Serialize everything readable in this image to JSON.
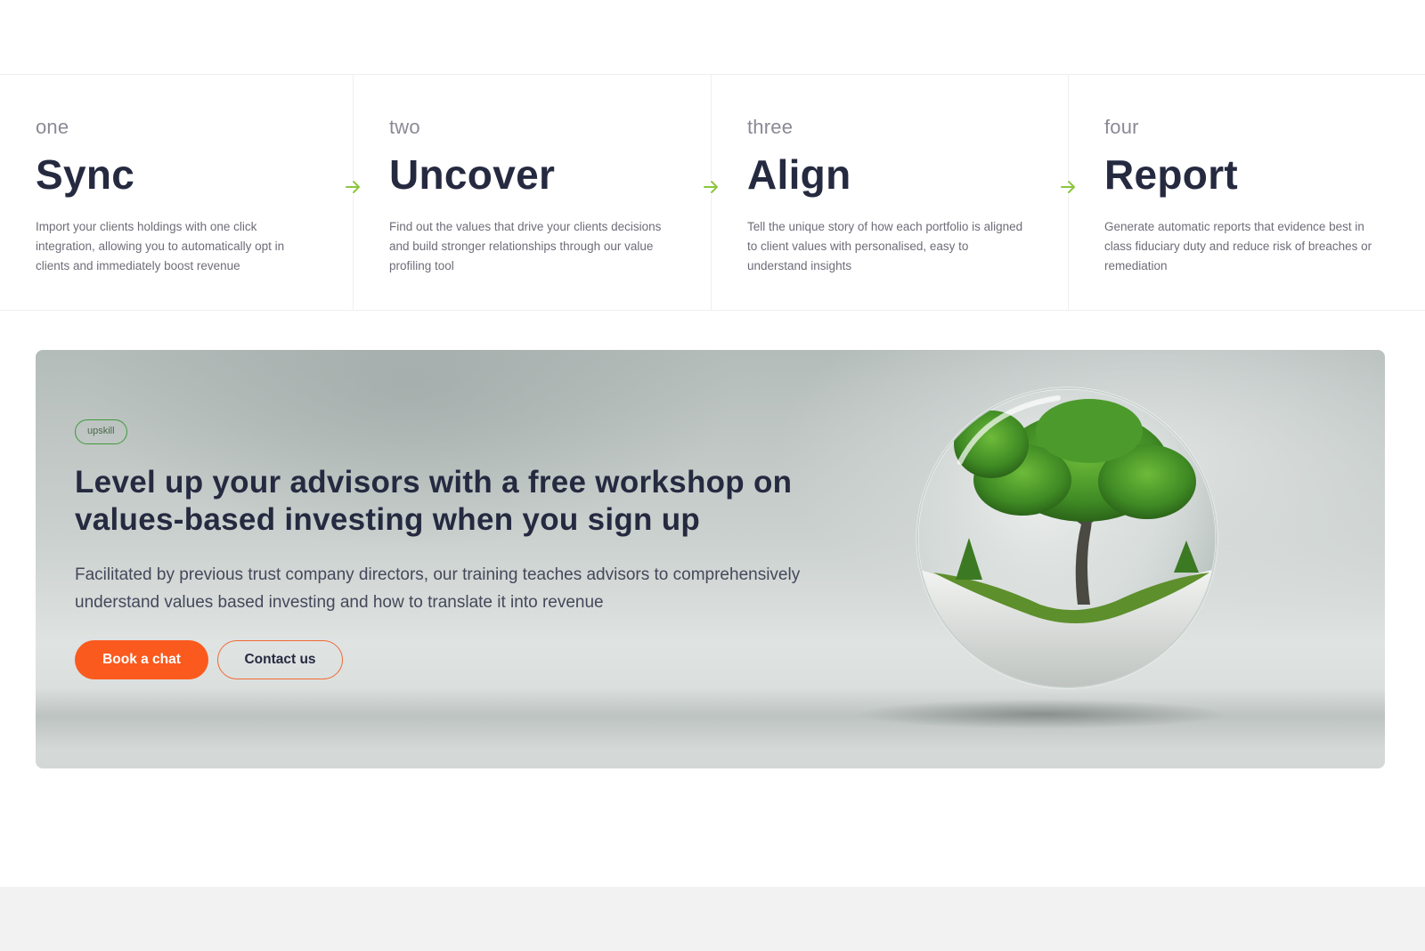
{
  "steps": [
    {
      "number": "one",
      "title": "Sync",
      "description": "Import your clients holdings with one click integration, allowing you to automatically opt in clients and immediately boost revenue"
    },
    {
      "number": "two",
      "title": "Uncover",
      "description": "Find out the values that drive your clients decisions and build stronger relationships through our value profiling tool"
    },
    {
      "number": "three",
      "title": "Align",
      "description": "Tell the unique story of how each portfolio is aligned to client values with personalised, easy to understand insights"
    },
    {
      "number": "four",
      "title": "Report",
      "description": "Generate automatic reports that evidence best in class fiduciary duty and reduce risk of breaches or remediation"
    }
  ],
  "step_arrow_icon": "arrow-right-icon",
  "colors": {
    "accent_green": "#8cc63f",
    "primary_orange": "#fa5a1e",
    "heading": "#262a40"
  },
  "banner": {
    "badge": "upskill",
    "title": "Level up your advisors with a free workshop on values-based investing when you sign up",
    "text": "Facilitated by previous trust company directors, our training teaches advisors to comprehensively understand values based investing and how to translate it into revenue",
    "primary_button": "Book a chat",
    "secondary_button": "Contact us",
    "image_icon": "tree-in-glass-sphere-image"
  }
}
